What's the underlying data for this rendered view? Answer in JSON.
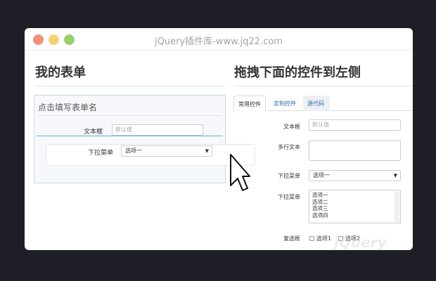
{
  "window": {
    "title": "jQuery插件库-www.jq22.com"
  },
  "left": {
    "heading": "我的表单",
    "form_name": "点击填写表单名",
    "text_row": {
      "label": "文本框",
      "placeholder": "默认值"
    },
    "drag_row": {
      "label": "下拉菜单",
      "selected": "选项一"
    }
  },
  "right": {
    "heading": "拖拽下面的控件到左侧",
    "tabs": [
      {
        "label": "常用控件",
        "active": true
      },
      {
        "label": "定制控件",
        "active": false
      },
      {
        "label": "源代码",
        "active": false
      }
    ],
    "fields": {
      "text": {
        "label": "文本框",
        "placeholder": "默认值"
      },
      "textarea": {
        "label": "多行文本"
      },
      "select": {
        "label": "下拉菜单",
        "selected": "选项一"
      },
      "multiselect": {
        "label": "下拉菜单",
        "options": [
          "选项一",
          "选项二",
          "选项三",
          "选项四"
        ]
      },
      "checkbox": {
        "label": "复选框",
        "options": [
          "选项1",
          "选项2"
        ]
      }
    }
  },
  "watermark": "jQuery",
  "colors": {
    "background": "#1e1f26",
    "accent": "#2a6fb5",
    "active_line": "#5fb0e8"
  }
}
